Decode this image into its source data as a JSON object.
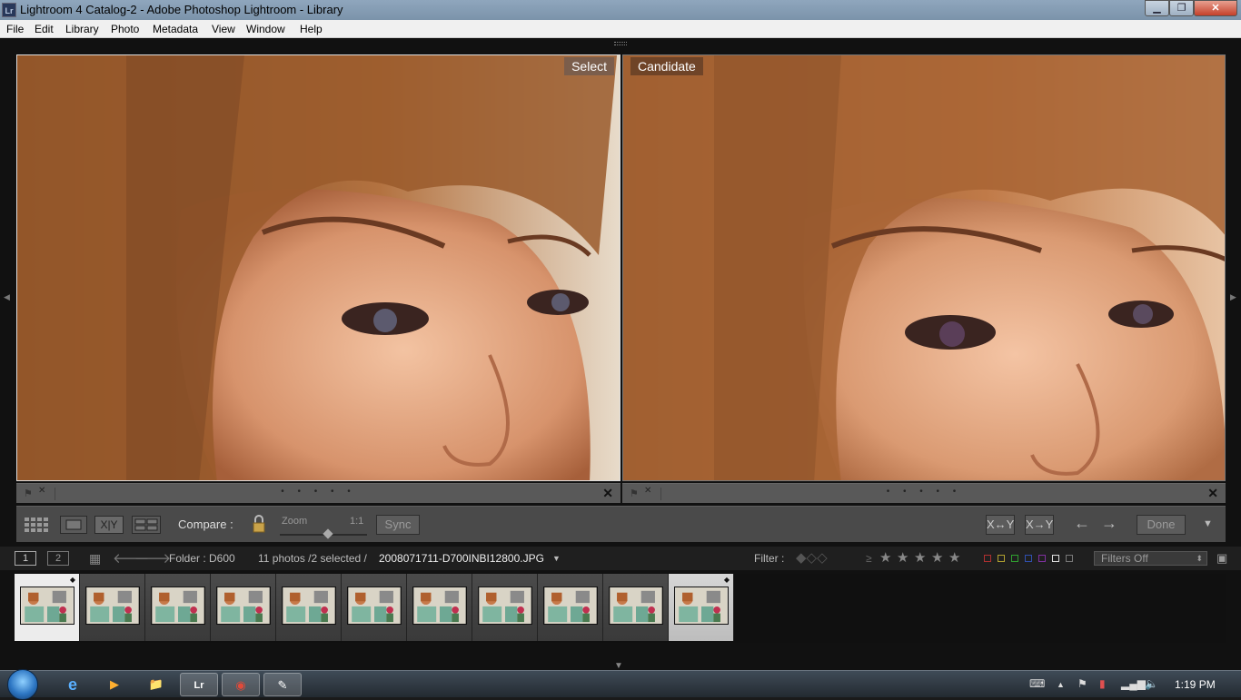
{
  "window": {
    "title": "Lightroom 4 Catalog-2 - Adobe Photoshop Lightroom - Library",
    "app_icon_text": "Lr",
    "min_label": "▁",
    "max_label": "❐",
    "close_label": "✕"
  },
  "menu": [
    "File",
    "Edit",
    "Library",
    "Photo",
    "Metadata",
    "View",
    "Window",
    "Help"
  ],
  "compare": {
    "select_label": "Select",
    "candidate_label": "Candidate",
    "dots": "• • • • •"
  },
  "toolbar": {
    "compare_label": "Compare :",
    "zoom_label": "Zoom",
    "zoom_value": "1:1",
    "zoom_level": 0.55,
    "xy_label": "X|Y",
    "sync_label": "Sync",
    "swap_label": "X↔Y",
    "make_select_label": "X→Y",
    "done_label": "Done",
    "prev_arrow": "←",
    "next_arrow": "→",
    "menu_arrow": "▼"
  },
  "filmbar": {
    "view1": "1",
    "view2": "2",
    "folder": "Folder : D600",
    "count": "11 photos /2 selected /",
    "filename": "2008071711-D700INBI12800.JPG",
    "filter_label": "Filter :",
    "gte": "≥",
    "stars": [
      "★",
      "★",
      "★",
      "★",
      "★"
    ],
    "color_labels": [
      "#b03030",
      "#b0a030",
      "#30a030",
      "#3050b0",
      "#8030a0",
      "#dddddd",
      "#777777"
    ],
    "filters_dropdown": "Filters Off"
  },
  "filmstrip": {
    "thumbs": [
      {
        "state": "lead"
      },
      {
        "state": "normal"
      },
      {
        "state": "normal"
      },
      {
        "state": "normal"
      },
      {
        "state": "normal"
      },
      {
        "state": "normal"
      },
      {
        "state": "normal"
      },
      {
        "state": "normal"
      },
      {
        "state": "normal"
      },
      {
        "state": "normal"
      },
      {
        "state": "selected"
      }
    ]
  },
  "taskbar": {
    "apps": [
      "e",
      "▶",
      "📁",
      "Lr",
      "◉",
      "✎"
    ],
    "clock": "1:19 PM"
  }
}
